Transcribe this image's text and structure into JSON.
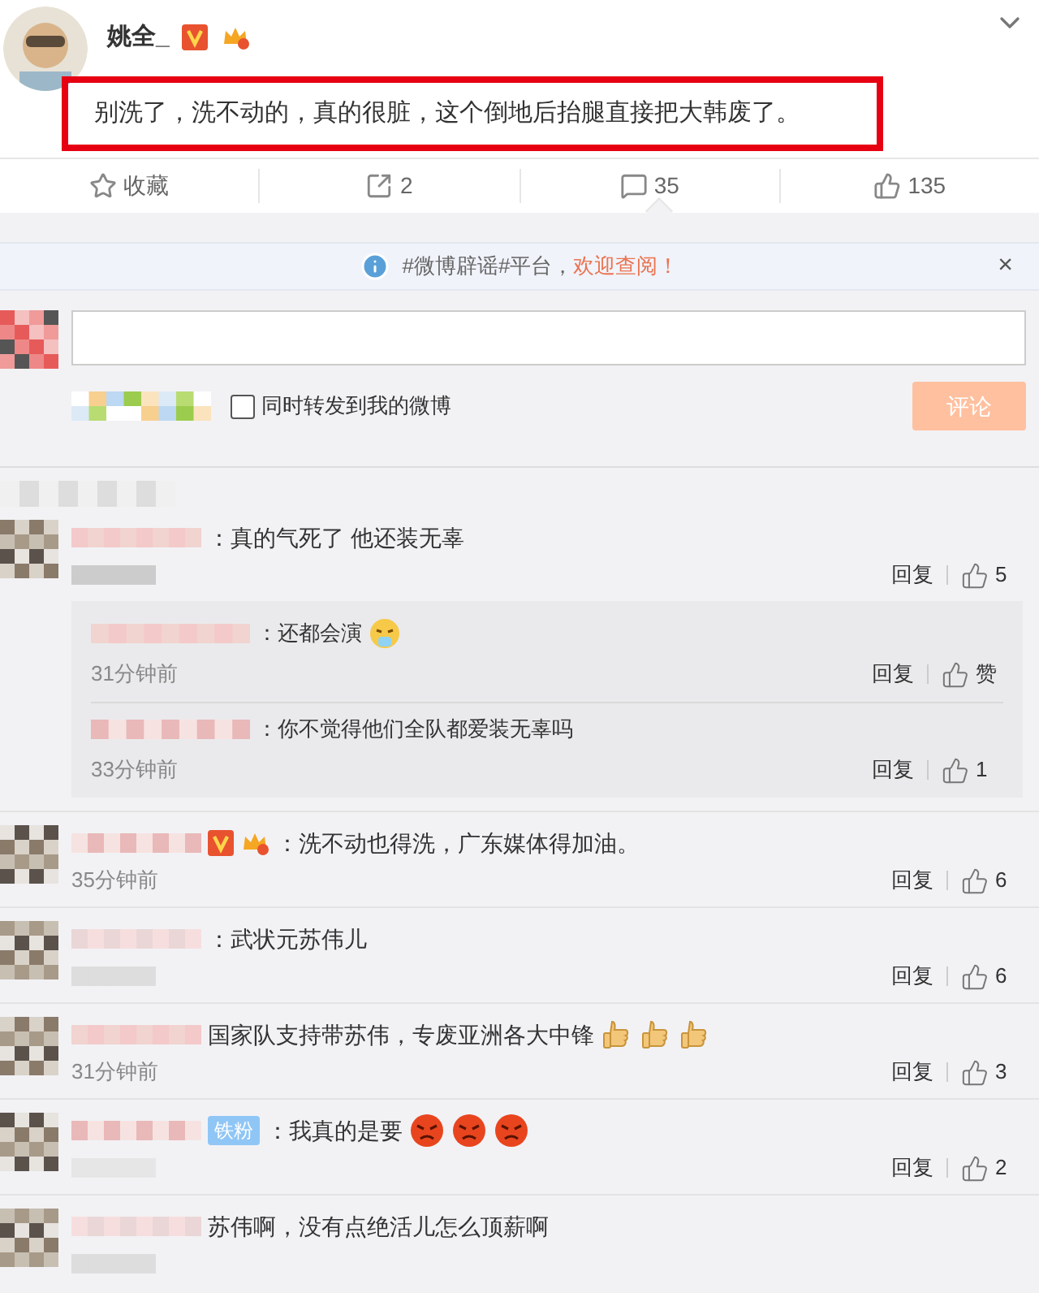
{
  "post": {
    "author": "姚全_",
    "badges": [
      {
        "kind": "v"
      },
      {
        "kind": "crown"
      }
    ],
    "text": "别洗了，洗不动的，真的很脏，这个倒地后抬腿直接把大韩废了。",
    "highlighted": true,
    "actions": [
      {
        "kind": "favorite",
        "label": "收藏",
        "selected": false
      },
      {
        "kind": "repost",
        "label": "2",
        "selected": false
      },
      {
        "kind": "comment",
        "label": "35",
        "selected": true
      },
      {
        "kind": "like",
        "label": "135",
        "selected": false
      }
    ]
  },
  "notice": {
    "text": "#微博辟谣#平台，",
    "link": "欢迎查阅！",
    "close": "×"
  },
  "composer": {
    "repost_label": "同时转发到我的微博",
    "checked": false,
    "submit": "评论"
  },
  "comments": [
    {
      "text": "：真的气死了 他还装无辜",
      "reply": "回复",
      "likes": "5",
      "replies": [
        {
          "text": "：还都会演",
          "emojis": [
            {
              "kind": "steam"
            }
          ],
          "time": "31分钟前",
          "reply": "回复",
          "likes": "赞"
        },
        {
          "text": "：你不觉得他们全队都爱装无辜吗",
          "time": "33分钟前",
          "reply": "回复",
          "likes": "1"
        }
      ]
    },
    {
      "badges": [
        {
          "kind": "v"
        },
        {
          "kind": "crown"
        }
      ],
      "text": "：洗不动也得洗，广东媒体得加油。",
      "time": "35分钟前",
      "reply": "回复",
      "likes": "6"
    },
    {
      "text": "：武状元苏伟儿",
      "reply": "回复",
      "likes": "6"
    },
    {
      "text": "国家队支持带苏伟，专废亚洲各大中锋",
      "emojis": [
        {
          "kind": "thumb"
        },
        {
          "kind": "thumb"
        },
        {
          "kind": "thumb"
        }
      ],
      "time": "31分钟前",
      "reply": "回复",
      "likes": "3"
    },
    {
      "tag": "铁粉",
      "text": "：我真的是要",
      "emojis": [
        {
          "kind": "angry"
        },
        {
          "kind": "angry"
        },
        {
          "kind": "angry"
        }
      ],
      "reply": "回复",
      "likes": "2"
    },
    {
      "text": "苏伟啊，没有点绝活儿怎么顶薪啊"
    }
  ]
}
